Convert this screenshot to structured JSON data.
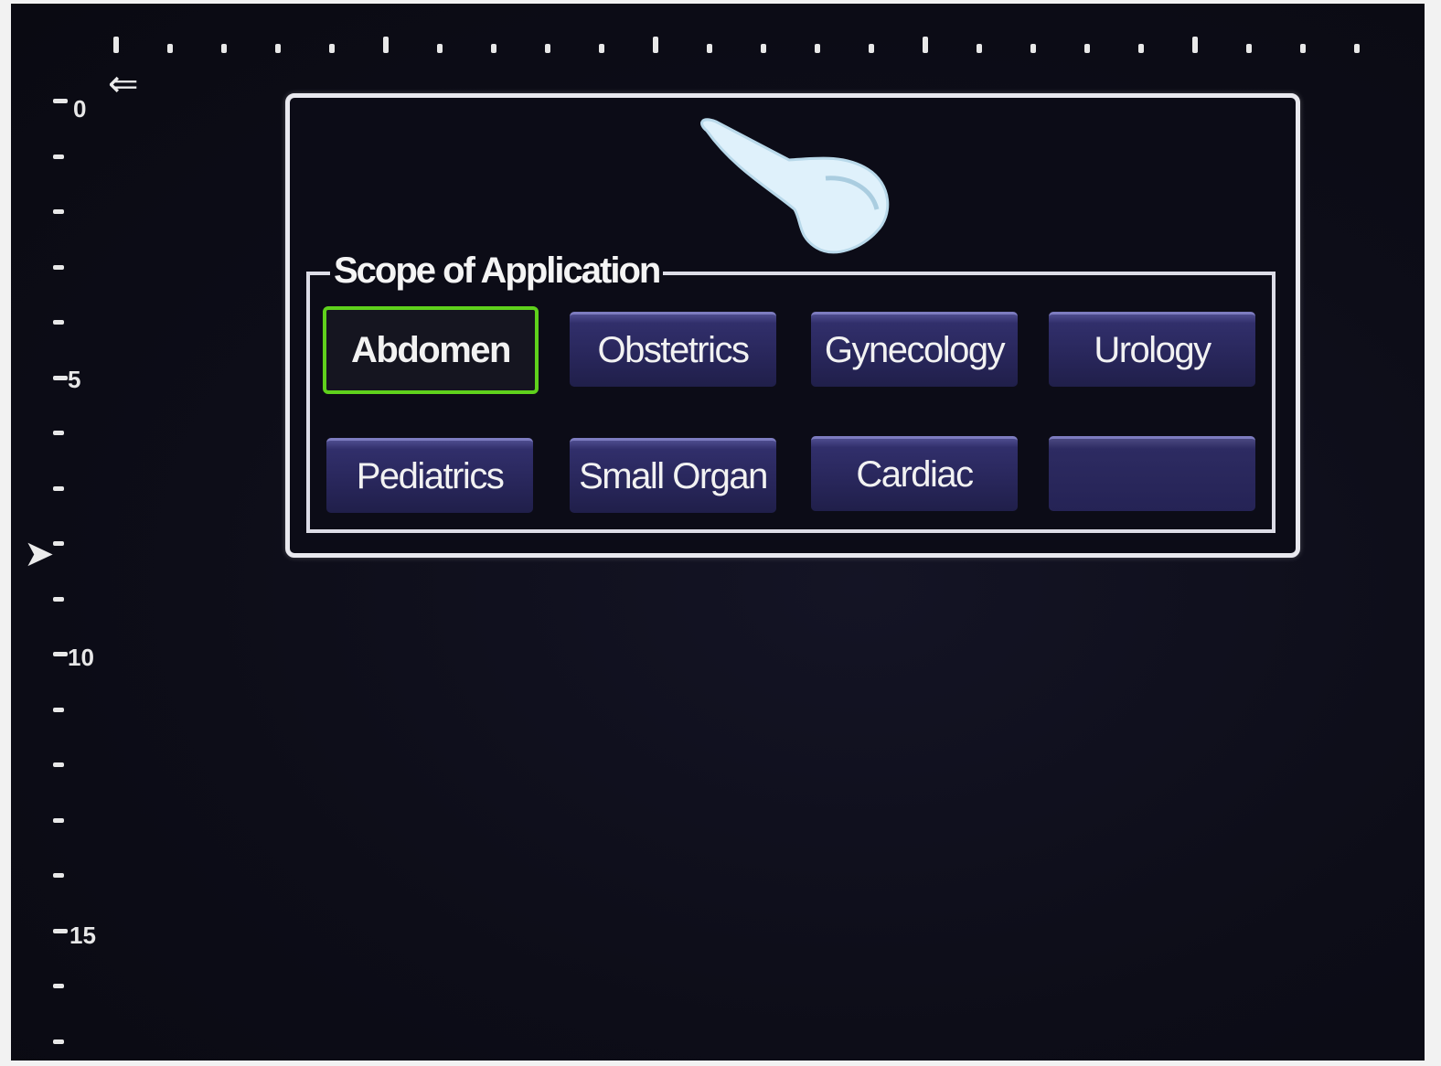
{
  "ruler": {
    "depth_labels": [
      "0",
      "5",
      "10",
      "15"
    ]
  },
  "navigation": {
    "back_icon": "back-arrow-icon",
    "focus_icon": "focus-marker-icon"
  },
  "dialog": {
    "probe_icon": "transducer-probe-icon",
    "scope": {
      "title": "Scope of Application",
      "buttons": [
        {
          "label": "Abdomen",
          "selected": true
        },
        {
          "label": "Obstetrics",
          "selected": false
        },
        {
          "label": "Gynecology",
          "selected": false
        },
        {
          "label": "Urology",
          "selected": false
        },
        {
          "label": "Pediatrics",
          "selected": false
        },
        {
          "label": "Small Organ",
          "selected": false
        },
        {
          "label": "Cardiac",
          "selected": false
        },
        {
          "label": "",
          "selected": false
        }
      ]
    }
  },
  "colors": {
    "selected_border": "#5fd11c",
    "button_fill": "#28265a",
    "frame": "#e9e9ef"
  }
}
